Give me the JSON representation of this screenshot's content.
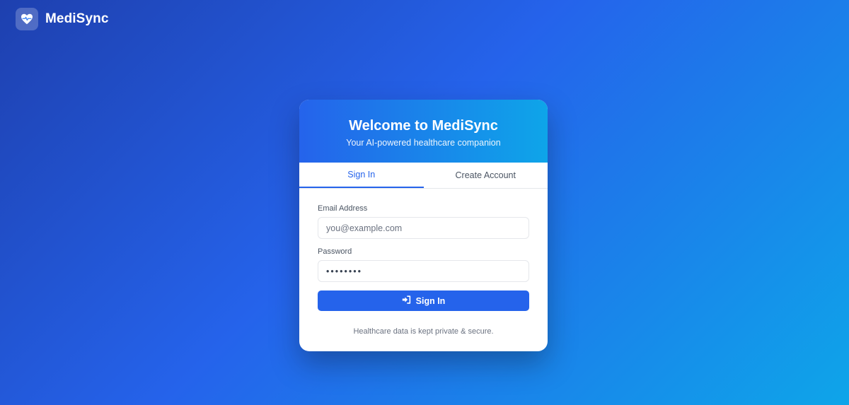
{
  "brand": {
    "name": "MediSync",
    "icon": "heart-pulse-icon"
  },
  "card": {
    "title": "Welcome to MediSync",
    "subtitle": "Your AI-powered healthcare companion"
  },
  "tabs": [
    {
      "label": "Sign In",
      "active": true
    },
    {
      "label": "Create Account",
      "active": false
    }
  ],
  "form": {
    "email": {
      "label": "Email Address",
      "placeholder": "you@example.com",
      "value": ""
    },
    "password": {
      "label": "Password",
      "value": "••••••••"
    },
    "submit": {
      "label": "Sign In",
      "icon": "sign-in-icon"
    }
  },
  "footer": {
    "note": "Healthcare data is kept private & secure."
  },
  "colors": {
    "primary": "#2563eb",
    "accent": "#0ea5e9",
    "background_start": "#1e40af"
  }
}
